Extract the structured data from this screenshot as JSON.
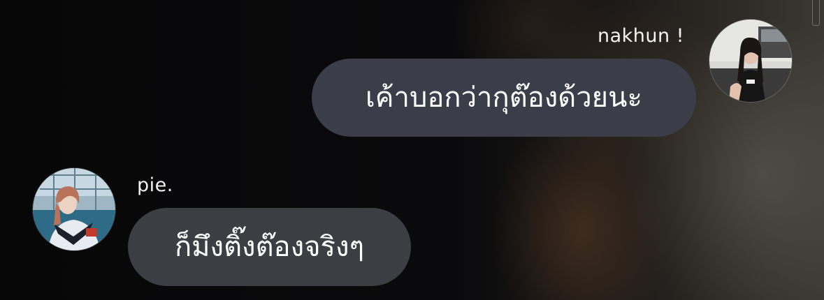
{
  "messages": [
    {
      "sender": "nakhun !",
      "text": "เค้าบอกว่ากุต๊องด้วยนะ",
      "side": "right"
    },
    {
      "sender": "pie.",
      "text": "ก็มึงติ๊งต๊องจริงๆ",
      "side": "left"
    }
  ],
  "colors": {
    "bubble": "#3e4049",
    "text": "#ffffff",
    "background": "#0b0b0d"
  },
  "icons": {
    "sender_1_avatar": "avatar-photo",
    "sender_2_avatar": "avatar-photo"
  }
}
